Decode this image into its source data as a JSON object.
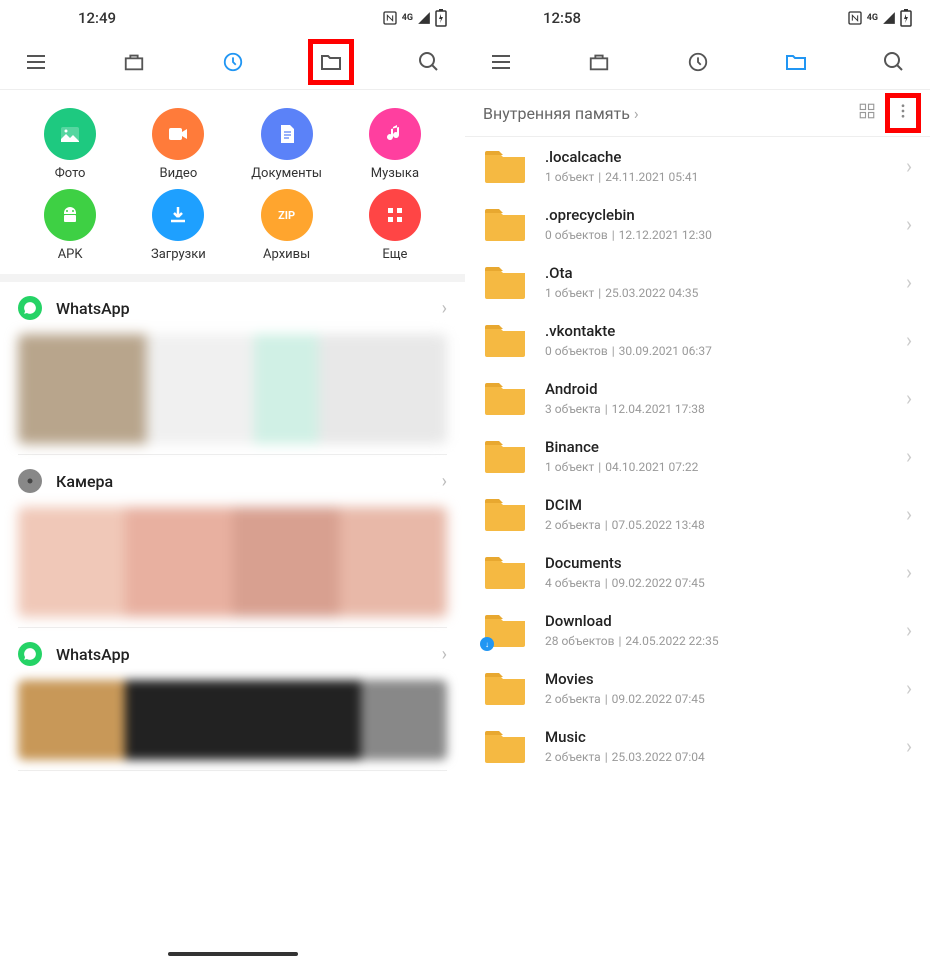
{
  "left": {
    "time": "12:49",
    "categories": [
      {
        "label": "Фото",
        "color": "#1ec980",
        "icon": "photo"
      },
      {
        "label": "Видео",
        "color": "#ff7b3a",
        "icon": "video"
      },
      {
        "label": "Документы",
        "color": "#5b82f8",
        "icon": "doc"
      },
      {
        "label": "Музыка",
        "color": "#ff3f9f",
        "icon": "music"
      },
      {
        "label": "APK",
        "color": "#3ed044",
        "icon": "apk"
      },
      {
        "label": "Загрузки",
        "color": "#1ea0ff",
        "icon": "download"
      },
      {
        "label": "Архивы",
        "color": "#ffa52e",
        "icon": "zip"
      },
      {
        "label": "Еще",
        "color": "#ff4545",
        "icon": "more"
      }
    ],
    "sections": [
      {
        "icon": "whatsapp",
        "title": "WhatsApp",
        "color": "#25d366"
      },
      {
        "icon": "camera",
        "title": "Камера",
        "color": "#888"
      },
      {
        "icon": "whatsapp",
        "title": "WhatsApp",
        "color": "#25d366"
      }
    ]
  },
  "right": {
    "time": "12:58",
    "breadcrumb": "Внутренняя память",
    "folders": [
      {
        "name": ".localcache",
        "count": "1 объект",
        "date": "24.11.2021 05:41"
      },
      {
        "name": ".oprecyclebin",
        "count": "0 объектов",
        "date": "12.12.2021 12:30"
      },
      {
        "name": ".Ota",
        "count": "1 объект",
        "date": "25.03.2022 04:35"
      },
      {
        "name": ".vkontakte",
        "count": "0 объектов",
        "date": "30.09.2021 06:37"
      },
      {
        "name": "Android",
        "count": "3 объекта",
        "date": "12.04.2021 17:38"
      },
      {
        "name": "Binance",
        "count": "1 объект",
        "date": "04.10.2021 07:22"
      },
      {
        "name": "DCIM",
        "count": "2 объекта",
        "date": "07.05.2022 13:48"
      },
      {
        "name": "Documents",
        "count": "4 объекта",
        "date": "09.02.2022 07:45"
      },
      {
        "name": "Download",
        "count": "28 объектов",
        "date": "24.05.2022 22:35",
        "badge": true
      },
      {
        "name": "Movies",
        "count": "2 объекта",
        "date": "09.02.2022 07:45"
      },
      {
        "name": "Music",
        "count": "2 объекта",
        "date": "25.03.2022 07:04"
      }
    ]
  }
}
